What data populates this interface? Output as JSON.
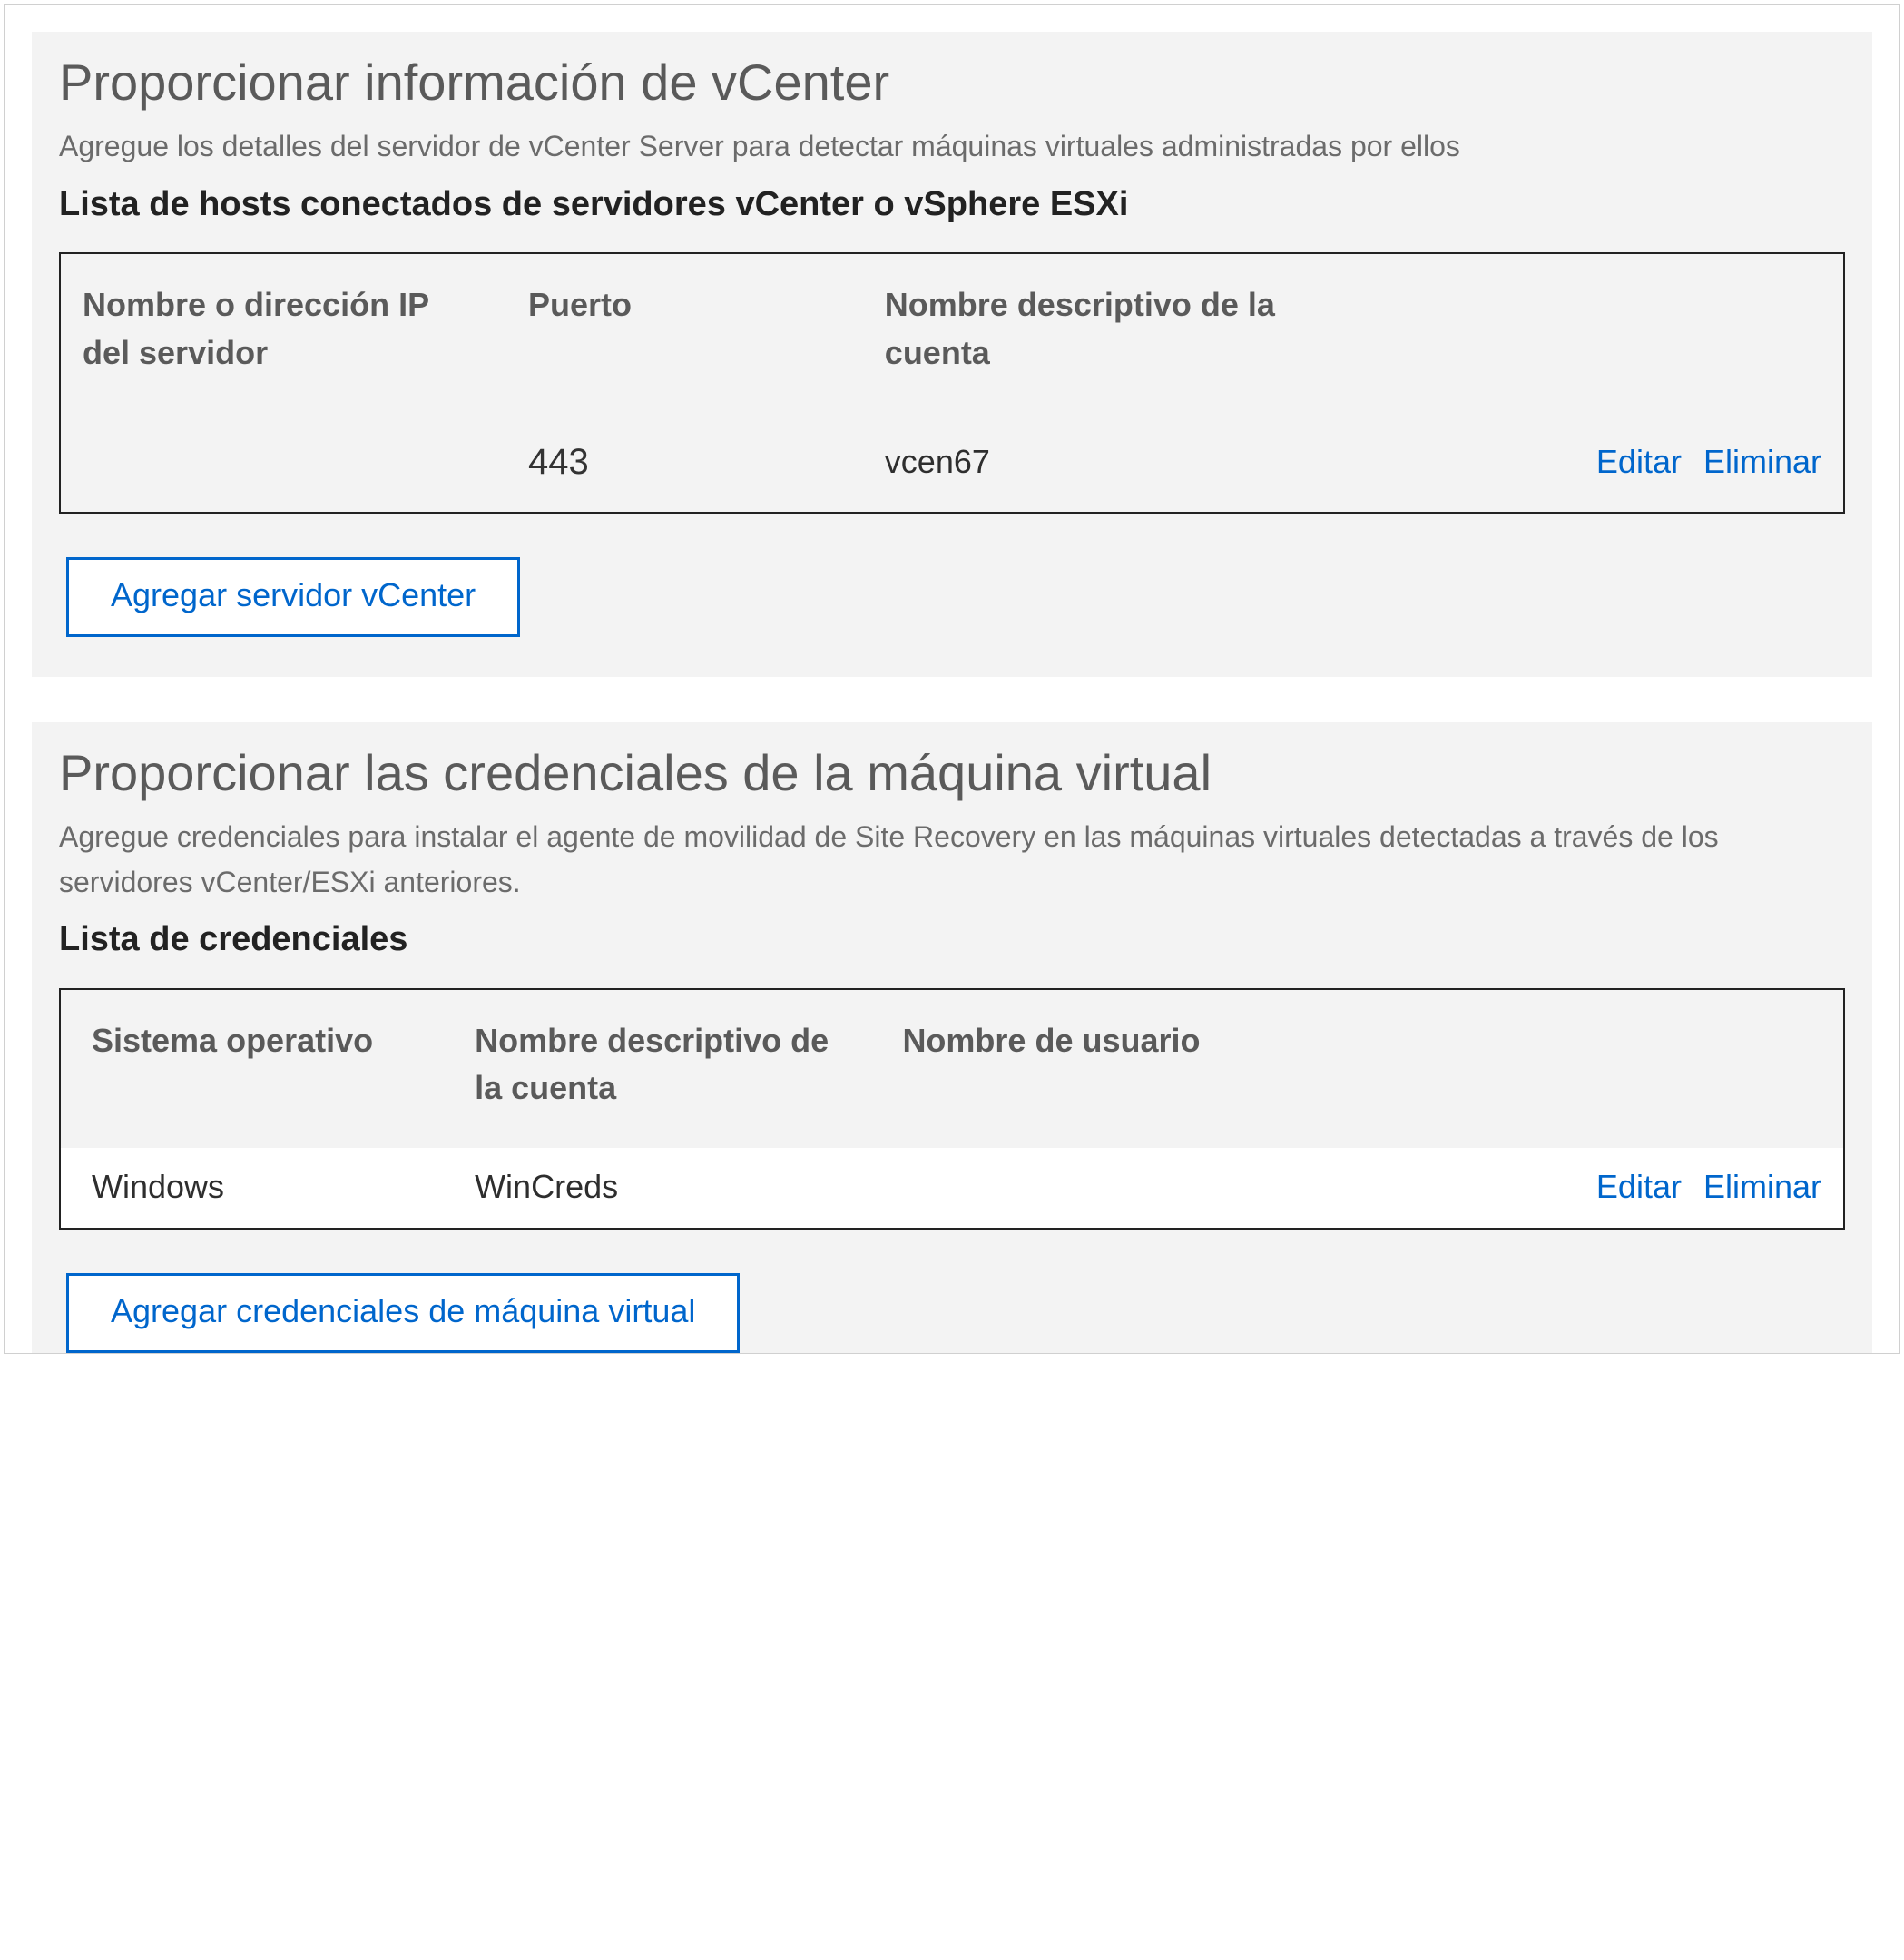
{
  "vcenter": {
    "title": "Proporcionar información de vCenter",
    "description": "Agregue los detalles del servidor de vCenter Server para detectar máquinas virtuales administradas por ellos",
    "list_title": "Lista de hosts conectados de servidores vCenter o vSphere ESXi",
    "columns": {
      "server": "Nombre o dirección IP del servidor",
      "port": "Puerto",
      "friendly": "Nombre descriptivo de la cuenta"
    },
    "rows": [
      {
        "server": "",
        "port": "443",
        "friendly": "vcen67"
      }
    ],
    "actions": {
      "edit": "Editar",
      "delete": "Eliminar"
    },
    "add_button": "Agregar servidor vCenter"
  },
  "vm_creds": {
    "title": "Proporcionar las credenciales de la máquina virtual",
    "description": "Agregue credenciales para instalar el agente de movilidad de Site Recovery en las máquinas virtuales detectadas a través de los servidores vCenter/ESXi anteriores.",
    "list_title": "Lista de credenciales",
    "columns": {
      "os": "Sistema operativo",
      "friendly": "Nombre descriptivo de la cuenta",
      "user": "Nombre de usuario"
    },
    "rows": [
      {
        "os": "Windows",
        "friendly": "WinCreds",
        "user": ""
      }
    ],
    "actions": {
      "edit": "Editar",
      "delete": "Eliminar"
    },
    "add_button": "Agregar credenciales de máquina virtual"
  }
}
